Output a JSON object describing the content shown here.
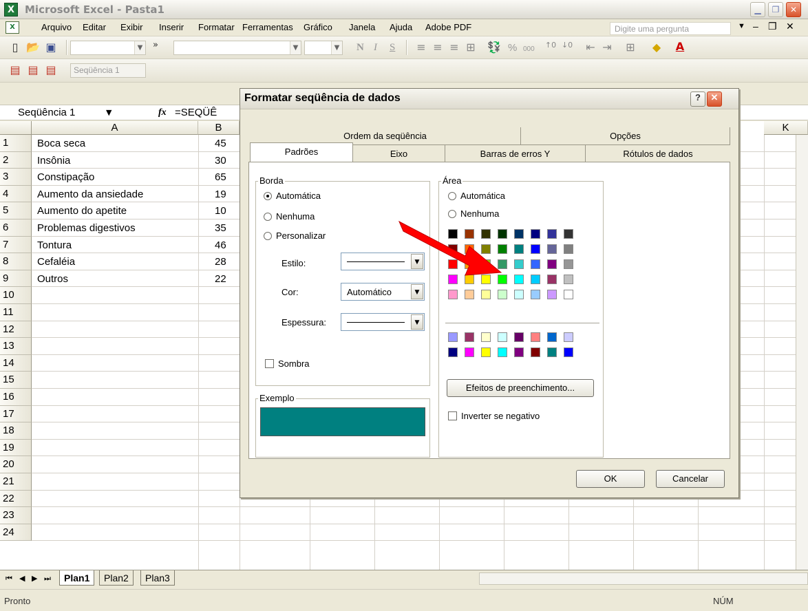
{
  "window": {
    "app_icon": "excel-icon",
    "title": "Microsoft Excel - Pasta1",
    "buttons": [
      "minimize-icon",
      "restore-icon",
      "close-icon"
    ]
  },
  "menu": {
    "items": [
      "Arquivo",
      "Editar",
      "Exibir",
      "Inserir",
      "Formatar",
      "Ferramentas",
      "Gráfico",
      "Janela",
      "Ajuda",
      "Adobe PDF"
    ],
    "ask_placeholder": "Digite uma pergunta"
  },
  "toolbar": {
    "chart_object_combo": "Seqüência 1",
    "bold": "N",
    "italic": "I",
    "underline": "S",
    "percent": "%",
    "thousands": "000"
  },
  "formula_bar": {
    "name_box": "Seqüência 1",
    "fx": "fx",
    "formula": "=SEQÜÊ"
  },
  "sheet": {
    "columns": [
      "A",
      "B",
      "K"
    ],
    "row_numbers": [
      "1",
      "2",
      "3",
      "4",
      "5",
      "6",
      "7",
      "8",
      "9",
      "10",
      "11",
      "12",
      "13",
      "14",
      "15",
      "16",
      "17",
      "18",
      "19",
      "20",
      "21",
      "22",
      "23",
      "24"
    ],
    "rows": [
      {
        "label": "Boca seca",
        "value": "45"
      },
      {
        "label": "Insônia",
        "value": "30"
      },
      {
        "label": "Constipação",
        "value": "65"
      },
      {
        "label": "Aumento da ansiedade",
        "value": "19"
      },
      {
        "label": "Aumento do apetite",
        "value": "10"
      },
      {
        "label": "Problemas digestivos",
        "value": "35"
      },
      {
        "label": "Tontura",
        "value": "46"
      },
      {
        "label": "Cefaléia",
        "value": "28"
      },
      {
        "label": "Outros",
        "value": "22"
      }
    ],
    "tabs": [
      "Plan1",
      "Plan2",
      "Plan3"
    ],
    "active_tab": "Plan1"
  },
  "status": {
    "left": "Pronto",
    "right": "NÚM"
  },
  "dialog": {
    "title": "Formatar seqüência de dados",
    "help": "?",
    "tabs_back": [
      "Ordem da seqüência",
      "Opções"
    ],
    "tabs_front": [
      "Padrões",
      "Eixo",
      "Barras de erros Y",
      "Rótulos de dados"
    ],
    "active_tab": "Padrões",
    "borda": {
      "legend": "Borda",
      "options": [
        "Automática",
        "Nenhuma",
        "Personalizar"
      ],
      "selected": "Automática",
      "estilo_label": "Estilo:",
      "cor_label": "Cor:",
      "cor_value": "Automático",
      "espessura_label": "Espessura:",
      "sombra": "Sombra"
    },
    "exemplo": {
      "legend": "Exemplo",
      "color": "#008080"
    },
    "area": {
      "legend": "Área",
      "options": [
        "Automática",
        "Nenhuma"
      ],
      "palette_main": [
        [
          "#000000",
          "#993300",
          "#333300",
          "#003300",
          "#003366",
          "#000080",
          "#333399",
          "#333333"
        ],
        [
          "#800000",
          "#ff6600",
          "#808000",
          "#008000",
          "#008080",
          "#0000ff",
          "#666699",
          "#808080"
        ],
        [
          "#ff0000",
          "#ff9900",
          "#99cc00",
          "#339966",
          "#33cccc",
          "#3366ff",
          "#800080",
          "#969696"
        ],
        [
          "#ff00ff",
          "#ffcc00",
          "#ffff00",
          "#00ff00",
          "#00ffff",
          "#00ccff",
          "#993366",
          "#c0c0c0"
        ],
        [
          "#ff99cc",
          "#ffcc99",
          "#ffff99",
          "#ccffcc",
          "#ccffff",
          "#99ccff",
          "#cc99ff",
          "#ffffff"
        ]
      ],
      "palette_extra": [
        [
          "#9999ff",
          "#993366",
          "#ffffcc",
          "#ccffff",
          "#660066",
          "#ff8080",
          "#0066cc",
          "#ccccff"
        ],
        [
          "#000080",
          "#ff00ff",
          "#ffff00",
          "#00ffff",
          "#800080",
          "#800000",
          "#008080",
          "#0000ff"
        ]
      ],
      "fill_effects": "Efeitos de preenchimento...",
      "invert": "Inverter se negativo"
    },
    "ok": "OK",
    "cancel": "Cancelar"
  },
  "annotation": {
    "icon": "red-arrow-icon",
    "color": "#ff0000"
  }
}
